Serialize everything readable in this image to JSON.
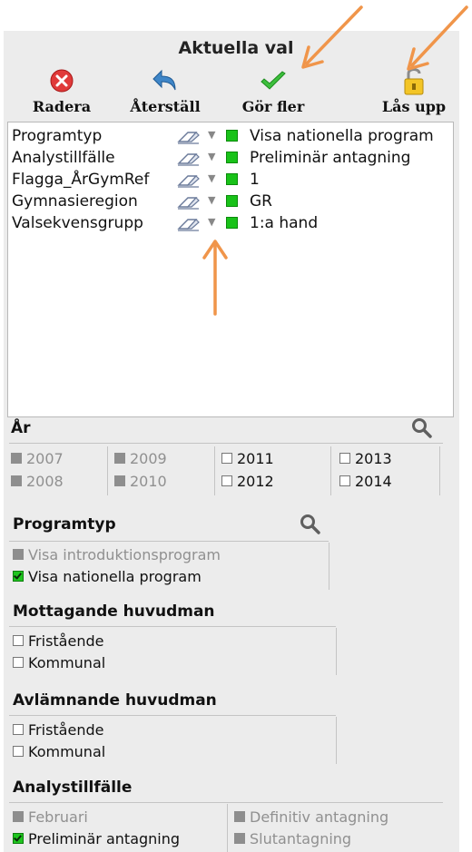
{
  "header": {
    "title": "Aktuella val"
  },
  "toolbar": {
    "delete_label": "Radera",
    "reset_label": "Återställ",
    "more_label": "Gör fler",
    "unlock_label": "Lås upp"
  },
  "selections": [
    {
      "field": "Programtyp",
      "value": "Visa nationella program"
    },
    {
      "field": "Analystillfälle",
      "value": "Preliminär antagning"
    },
    {
      "field": "Flagga_ÅrGymRef",
      "value": "1"
    },
    {
      "field": "Gymnasieregion",
      "value": "GR"
    },
    {
      "field": "Valsekvensgrupp",
      "value": "1:a hand"
    }
  ],
  "year": {
    "heading": "År",
    "items": [
      {
        "label": "2007",
        "state": "excluded"
      },
      {
        "label": "2009",
        "state": "excluded"
      },
      {
        "label": "2011",
        "state": "available"
      },
      {
        "label": "2013",
        "state": "available"
      },
      {
        "label": "2008",
        "state": "excluded"
      },
      {
        "label": "2010",
        "state": "excluded"
      },
      {
        "label": "2012",
        "state": "available"
      },
      {
        "label": "2014",
        "state": "available"
      }
    ]
  },
  "programtyp": {
    "heading": "Programtyp",
    "items": [
      {
        "label": "Visa introduktionsprogram",
        "state": "excluded"
      },
      {
        "label": "Visa nationella program",
        "state": "selected"
      }
    ]
  },
  "mottagande": {
    "heading": "Mottagande huvudman",
    "items": [
      {
        "label": "Fristående",
        "state": "available"
      },
      {
        "label": "Kommunal",
        "state": "available"
      }
    ]
  },
  "avlamnande": {
    "heading": "Avlämnande huvudman",
    "items": [
      {
        "label": "Fristående",
        "state": "available"
      },
      {
        "label": "Kommunal",
        "state": "available"
      }
    ]
  },
  "analystillfalle": {
    "heading": "Analystillfälle",
    "items": [
      {
        "label": "Februari",
        "state": "excluded"
      },
      {
        "label": "Definitiv antagning",
        "state": "excluded"
      },
      {
        "label": "Preliminär antagning",
        "state": "selected"
      },
      {
        "label": "Slutantagning",
        "state": "excluded"
      }
    ]
  },
  "colors": {
    "selected": "#1fc51f",
    "excluded": "#8e8e8e",
    "annotation_arrow": "#f0954a"
  },
  "icons": [
    "close-icon",
    "undo-icon",
    "checkmark-icon",
    "padlock-icon",
    "eraser-icon",
    "dropdown-arrow-icon",
    "magnifier-icon"
  ]
}
